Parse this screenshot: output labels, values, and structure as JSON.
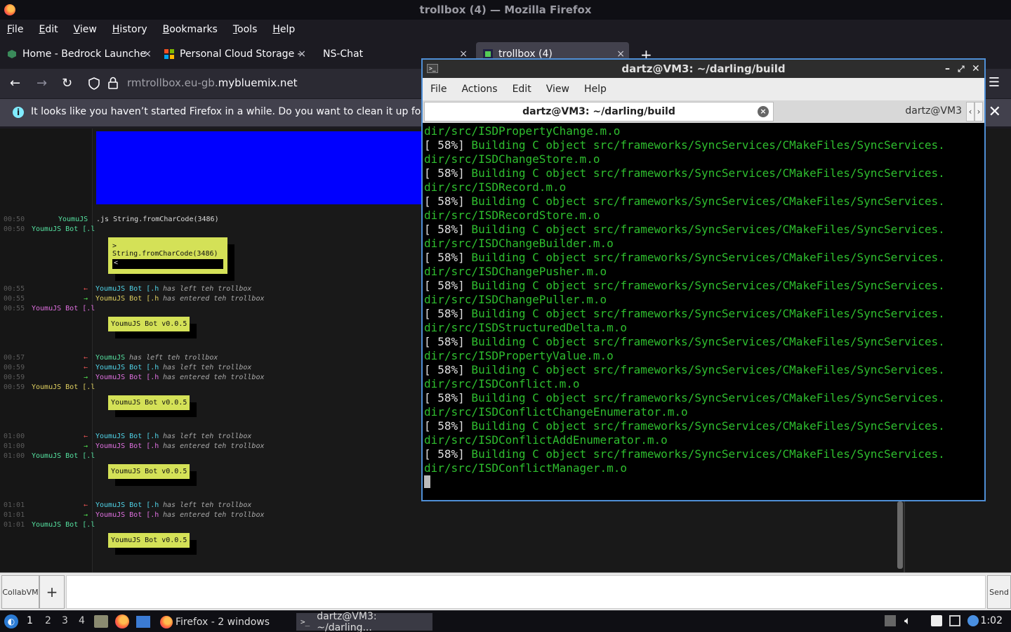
{
  "firefox": {
    "title": "trollbox (4) — Mozilla Firefox",
    "menus": [
      "File",
      "Edit",
      "View",
      "History",
      "Bookmarks",
      "Tools",
      "Help"
    ],
    "tabs": [
      {
        "label": "Home - Bedrock Launche",
        "close": "×"
      },
      {
        "label": "Personal Cloud Storage -",
        "close": "×"
      },
      {
        "label": "NS-Chat",
        "close": "×"
      },
      {
        "label": "trollbox (4)",
        "close": "×"
      }
    ],
    "new_tab": "+",
    "url_prefix": "rmtrollbox.eu-gb.",
    "url_domain": "mybluemix.net",
    "notice": "It looks like you haven’t started Firefox in a while. Do you want to clean it up for a f",
    "menu_icon": "☰"
  },
  "chat": {
    "lines": [
      {
        "ts": "00:50",
        "nick": "YoumuJS",
        "msg": ".js String.fromCharCode(3486)"
      },
      {
        "ts": "00:50",
        "nick": "YoumuJS Bot [.l"
      },
      {
        "ts": "00:55",
        "nick": "YoumuJS Bot [.h",
        "msg": "has left teh trollbox"
      },
      {
        "ts": "00:55",
        "nick": "YoumuJS Bot [.h",
        "msg": "has entered teh trollbox"
      },
      {
        "ts": "00:55",
        "nick": "YoumuJS Bot [.l"
      },
      {
        "ts": "00:57",
        "nick": "YoumuJS",
        "msg": "has left teh trollbox"
      },
      {
        "ts": "00:59",
        "nick": "YoumuJS Bot [.h",
        "msg": "has left teh trollbox"
      },
      {
        "ts": "00:59",
        "nick": "YoumuJS Bot [.h",
        "msg": "has entered teh trollbox"
      },
      {
        "ts": "00:59",
        "nick": "YoumuJS Bot [.l"
      },
      {
        "ts": "01:00",
        "nick": "YoumuJS Bot [.h",
        "msg": "has left teh trollbox"
      },
      {
        "ts": "01:00",
        "nick": "YoumuJS Bot [.h",
        "msg": "has entered teh trollbox"
      },
      {
        "ts": "01:00",
        "nick": "YoumuJS Bot [.l"
      },
      {
        "ts": "01:01",
        "nick": "YoumuJS Bot [.h",
        "msg": "has left teh trollbox"
      },
      {
        "ts": "01:01",
        "nick": "YoumuJS Bot [.h",
        "msg": "has entered teh trollbox"
      },
      {
        "ts": "01:01",
        "nick": "YoumuJS Bot [.l"
      }
    ],
    "js_box_line1": "> String.fromCharCode(3486)",
    "js_box_line2": "<",
    "bot_version": "YoumuJS Bot v0.0.5",
    "collab_label": "CollabVM",
    "plus_label": "+",
    "send_label": "Send"
  },
  "terminal": {
    "title": "dartz@VM3: ~/darling/build",
    "menus": [
      "File",
      "Actions",
      "Edit",
      "View",
      "Help"
    ],
    "tab_active": "dartz@VM3: ~/darling/build",
    "tab_other": "dartz@VM3",
    "first_line": "dir/src/ISDPropertyChange.m.o",
    "percent": "[ 58%]",
    "build_prefix": " Building C object src/frameworks/SyncServices/CMakeFiles/SyncServices.",
    "objects": [
      "dir/src/ISDChangeStore.m.o",
      "dir/src/ISDRecord.m.o",
      "dir/src/ISDRecordStore.m.o",
      "dir/src/ISDChangeBuilder.m.o",
      "dir/src/ISDChangePusher.m.o",
      "dir/src/ISDChangePuller.m.o",
      "dir/src/ISDStructuredDelta.m.o",
      "dir/src/ISDPropertyValue.m.o",
      "dir/src/ISDConflict.m.o",
      "dir/src/ISDConflictChangeEnumerator.m.o",
      "dir/src/ISDConflictAddEnumerator.m.o",
      "dir/src/ISDConflictManager.m.o"
    ]
  },
  "taskbar": {
    "desktops": [
      "1",
      "2",
      "3",
      "4"
    ],
    "firefox_task": "Firefox - 2 windows",
    "terminal_task": "dartz@VM3: ~/darling...",
    "clock": "1:02"
  },
  "colors": {
    "term_green": "#2fbf2f",
    "blue_box": "#0000ff",
    "bot_box": "#d4e157"
  }
}
